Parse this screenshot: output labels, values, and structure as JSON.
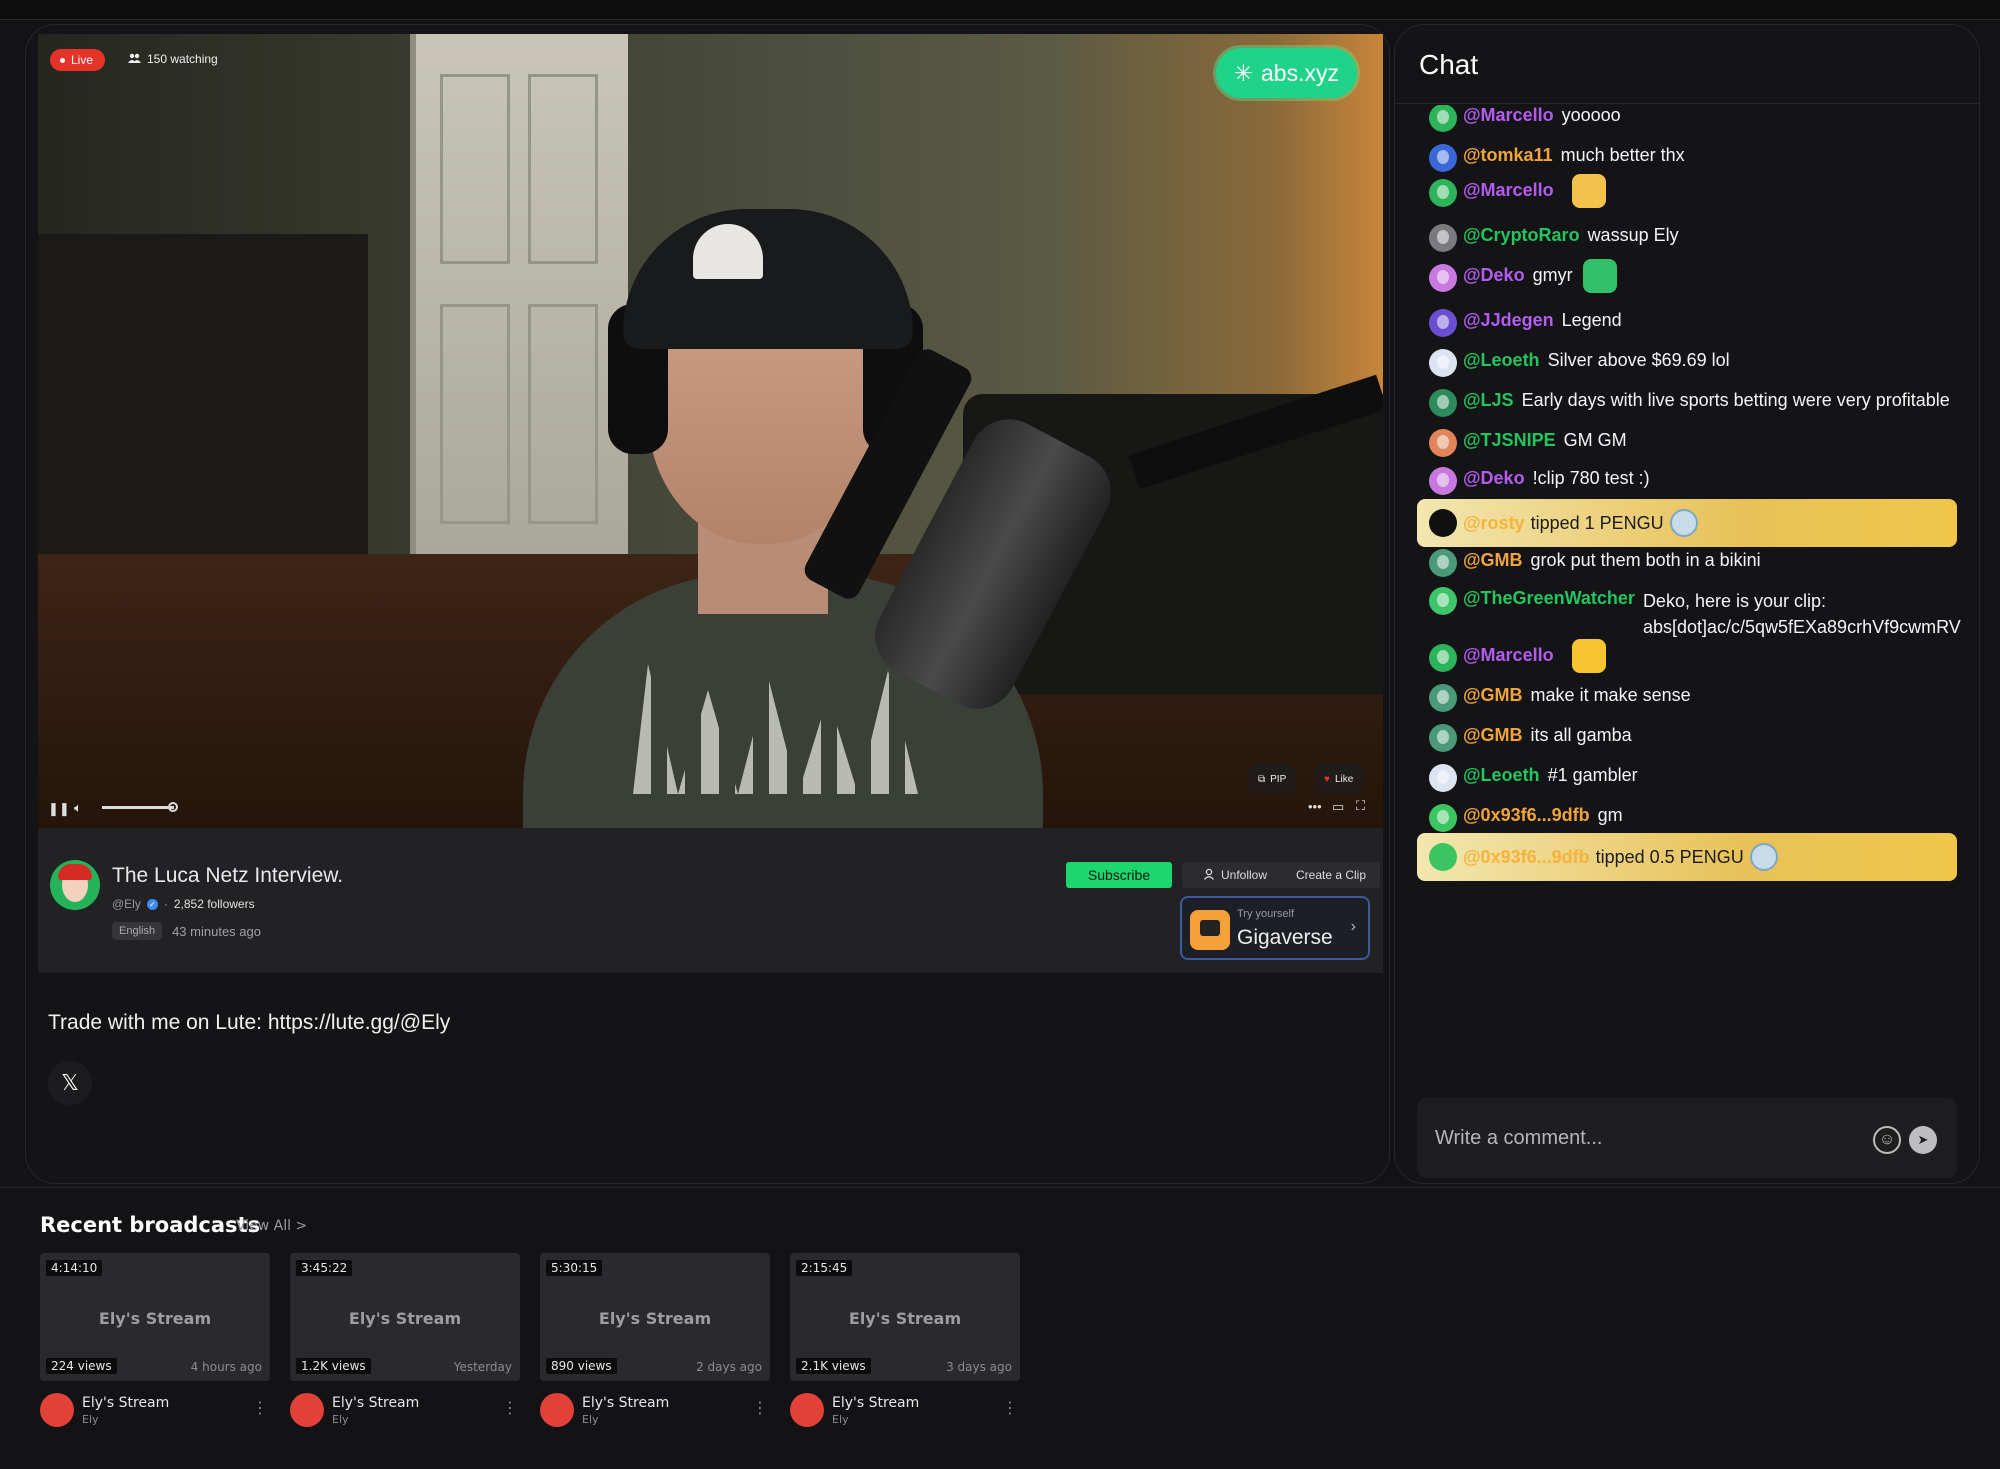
{
  "player": {
    "live_label": "Live",
    "watching": "150 watching",
    "abs_brand": "abs.xyz",
    "pip_label": "PIP",
    "like_label": "Like"
  },
  "stream": {
    "title": "The Luca Netz Interview.",
    "handle": "@Ely",
    "followers": "2,852 followers",
    "language": "English",
    "started": "43 minutes ago",
    "subscribe_label": "Subscribe",
    "unfollow_label": "Unfollow",
    "create_clip_label": "Create a Clip",
    "promo_small": "Try yourself",
    "promo_big": "Gigaverse"
  },
  "about": {
    "trade_text": "Trade with me on Lute: https://lute.gg/@Ely",
    "x_icon": "x-icon"
  },
  "chat": {
    "title": "Chat",
    "messages": [
      {
        "user": "@Marcello",
        "text": "yooooo",
        "color": "#b45cf0",
        "av": "#2db35a"
      },
      {
        "user": "@tomka11",
        "text": "much better thx",
        "color": "#f1a43a",
        "av": "#3b68d8"
      },
      {
        "user": "@Marcello",
        "text": "",
        "color": "#b45cf0",
        "av": "#2db35a",
        "emote": "#f2c24a"
      },
      {
        "user": "@CryptoRaro",
        "text": "wassup Ely",
        "color": "#22c55e",
        "av": "#7a7a80"
      },
      {
        "user": "@Deko",
        "text": "gmyr",
        "color": "#b45cf0",
        "av": "#c879e0",
        "emote": "#33c06a"
      },
      {
        "user": "@JJdegen",
        "text": "Legend",
        "color": "#b45cf0",
        "av": "#6a4fd0"
      },
      {
        "user": "@Leoeth",
        "text": "Silver above $69.69 lol",
        "color": "#22c55e",
        "av": "#dbe4f0"
      },
      {
        "user": "@LJS",
        "text": "Early days with live sports betting were very profitable",
        "color": "#22c55e",
        "av": "#2d8a5a"
      },
      {
        "user": "@TJSNIPE",
        "text": "GM GM",
        "color": "#22c55e",
        "av": "#e0865a"
      },
      {
        "user": "@Deko",
        "text": "!clip 780 test :)",
        "color": "#b45cf0",
        "av": "#c879e0"
      },
      {
        "user": "@GMB",
        "text": "grok put them both in a bikini",
        "color": "#f1a43a",
        "av": "#4a9a7a"
      },
      {
        "user": "@TheGreenWatcher",
        "text": "Deko, here is your clip: abs[dot]ac/c/5qw5fEXa89crhVf9cwmRV",
        "color": "#22c55e",
        "av": "#3fc46a"
      },
      {
        "user": "@Marcello",
        "text": "",
        "color": "#b45cf0",
        "av": "#2db35a",
        "emote": "#f7c531"
      },
      {
        "user": "@GMB",
        "text": "make it make sense",
        "color": "#f1a43a",
        "av": "#4a9a7a"
      },
      {
        "user": "@GMB",
        "text": "its all gamba",
        "color": "#f1a43a",
        "av": "#4a9a7a"
      },
      {
        "user": "@Leoeth",
        "text": "#1 gambler",
        "color": "#22c55e",
        "av": "#dbe4f0"
      },
      {
        "user": "@0x93f6...9dfb",
        "text": "gm",
        "color": "#f1a43a",
        "av": "#3cc460"
      }
    ],
    "tips": [
      {
        "user": "@rosty",
        "text": "tipped 1 PENGU",
        "av": "#111111"
      },
      {
        "user": "@0x93f6...9dfb",
        "text": "tipped 0.5 PENGU",
        "av": "#3cc460"
      }
    ],
    "comment_placeholder": "Write a comment..."
  },
  "recent": {
    "title": "Recent broadcasts",
    "view_all": "View All >",
    "items": [
      {
        "duration": "4:14:10",
        "title": "Ely's Stream",
        "views": "224 views",
        "ago": "4 hours ago",
        "name": "Ely's Stream",
        "channel": "Ely"
      },
      {
        "duration": "3:45:22",
        "title": "Ely's Stream",
        "views": "1.2K views",
        "ago": "Yesterday",
        "name": "Ely's Stream",
        "channel": "Ely"
      },
      {
        "duration": "5:30:15",
        "title": "Ely's Stream",
        "views": "890 views",
        "ago": "2 days ago",
        "name": "Ely's Stream",
        "channel": "Ely"
      },
      {
        "duration": "2:15:45",
        "title": "Ely's Stream",
        "views": "2.1K views",
        "ago": "3 days ago",
        "name": "Ely's Stream",
        "channel": "Ely"
      }
    ]
  }
}
